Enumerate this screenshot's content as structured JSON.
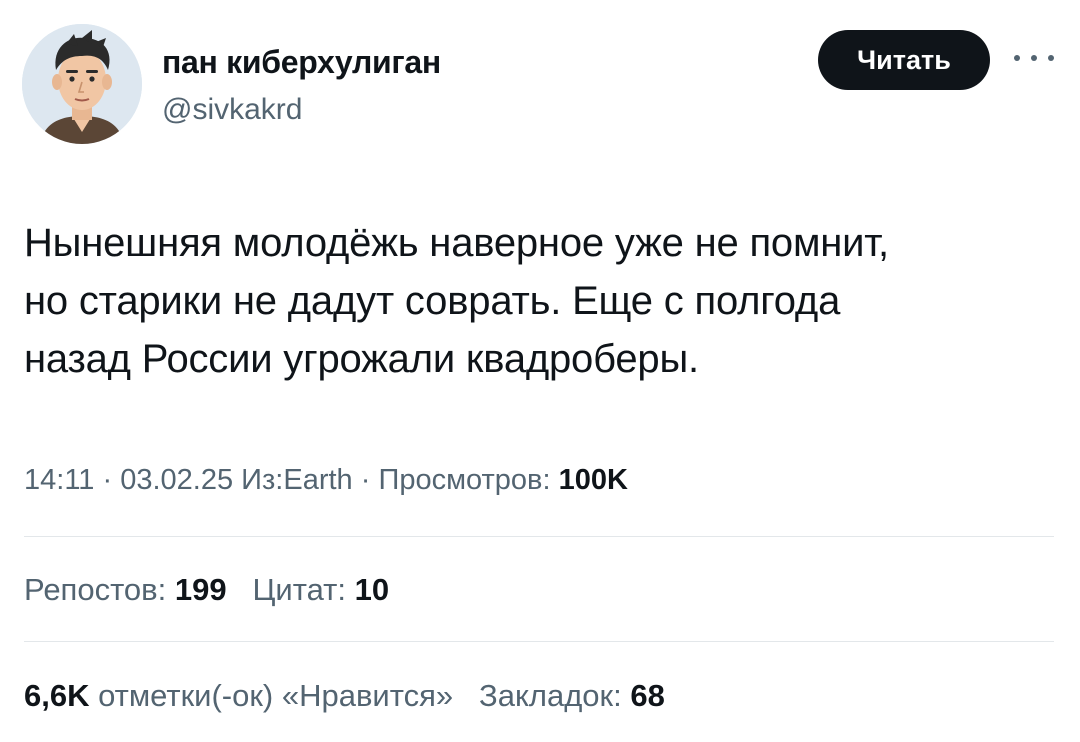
{
  "author": {
    "display_name": "пан киберхулиган",
    "handle": "@sivkakrd",
    "avatar_icon": "cartoon-man-avatar"
  },
  "actions": {
    "follow_label": "Читать",
    "more_icon": "more-dots-icon"
  },
  "tweet": {
    "lines": [
      "Нынешняя молодёжь наверное уже не помнит,",
      "но старики не дадут соврать. Еще с полгода",
      "назад России угрожали квадроберы."
    ]
  },
  "meta": {
    "time": "14:11",
    "separator": "·",
    "date": "03.02.25",
    "source": "Из:Earth",
    "views_label": "Просмотров:",
    "views_value": "100K"
  },
  "stats": {
    "reposts_label": "Репостов:",
    "reposts_value": "199",
    "quotes_label": "Цитат:",
    "quotes_value": "10",
    "likes_value": "6,6K",
    "likes_label": "отметки(-ок) «Нравится»",
    "bookmarks_label": "Закладок:",
    "bookmarks_value": "68"
  },
  "colors": {
    "text": "#0f1419",
    "secondary": "#536471",
    "divider": "#e3e7ea",
    "button_bg": "#0f1419",
    "button_text": "#ffffff"
  }
}
